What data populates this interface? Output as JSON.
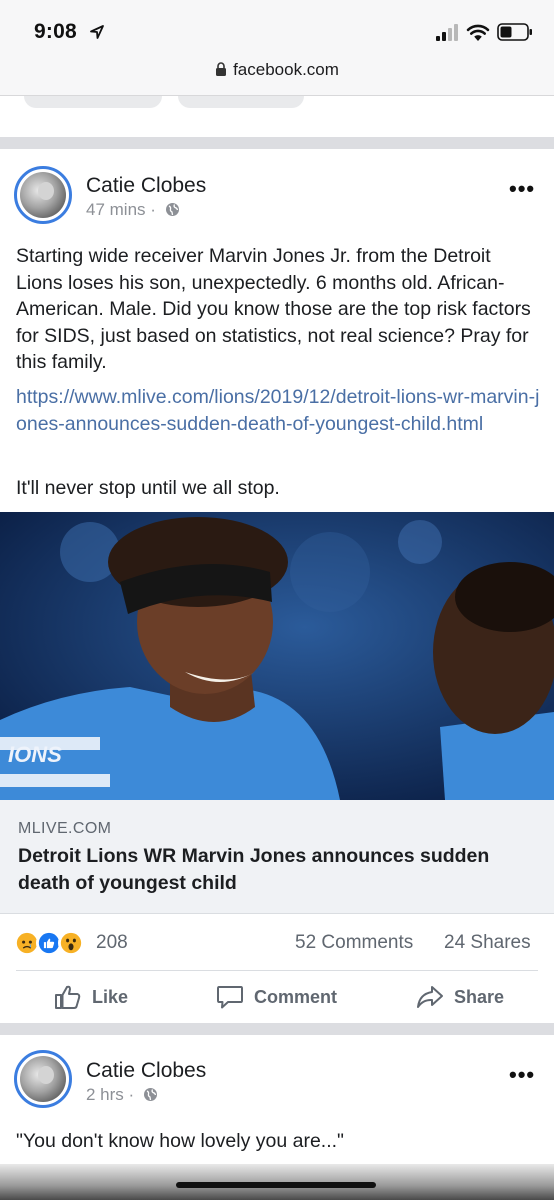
{
  "status_bar": {
    "time": "9:08"
  },
  "browser": {
    "url": "facebook.com"
  },
  "post1": {
    "author": "Catie Clobes",
    "time": "47 mins",
    "meta_sep": "·",
    "more": "•••",
    "text": "Starting wide receiver Marvin Jones Jr. from the Detroit Lions loses his son, unexpectedly. 6 months old. African-American. Male. Did you know those are the top risk factors for SIDS, just based on statistics, not real science? Pray for this family.",
    "link": "https://www.mlive.com/lions/2019/12/detroit-lions-wr-marvin-jones-announces-sudden-death-of-youngest-child.html",
    "text2": "It'll never stop until we all stop.",
    "preview": {
      "domain": "MLIVE.COM",
      "headline": "Detroit Lions WR Marvin Jones announces sudden death of youngest child"
    },
    "reactions": {
      "icons": [
        "sad-emoji-icon",
        "like-icon",
        "wow-emoji-icon"
      ],
      "count": "208",
      "comments": "52 Comments",
      "shares": "24 Shares"
    },
    "actions": {
      "like": "Like",
      "comment": "Comment",
      "share": "Share"
    }
  },
  "post2": {
    "author": "Catie Clobes",
    "time": "2 hrs",
    "meta_sep": "·",
    "more": "•••",
    "text": "\"You don't know how lovely you are...\""
  },
  "colors": {
    "link": "#4a6fa5",
    "avatar_ring": "#3b7de0",
    "like_blue": "#1877f2",
    "reaction_yellow": "#f7b125"
  }
}
